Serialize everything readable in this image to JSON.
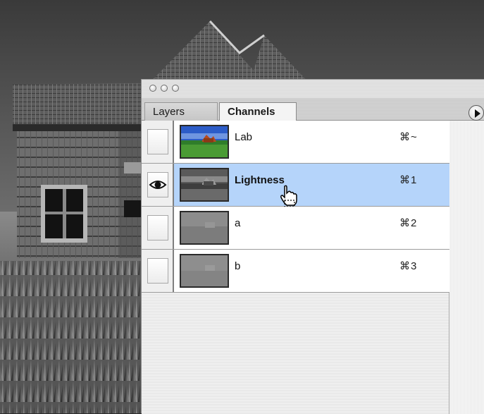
{
  "palette": {
    "tabs": [
      {
        "label": "Layers",
        "active": false
      },
      {
        "label": "Channels",
        "active": true
      }
    ],
    "menu_icon": "triangle-right-icon",
    "channels": [
      {
        "name": "Lab",
        "shortcut": "⌘~",
        "visible": false,
        "selected": false,
        "thumbnail": "color"
      },
      {
        "name": "Lightness",
        "shortcut": "⌘1",
        "visible": true,
        "selected": true,
        "thumbnail": "grayscale"
      },
      {
        "name": "a",
        "shortcut": "⌘2",
        "visible": false,
        "selected": false,
        "thumbnail": "flat-gray"
      },
      {
        "name": "b",
        "shortcut": "⌘3",
        "visible": false,
        "selected": false,
        "thumbnail": "flat-gray"
      }
    ]
  },
  "colors": {
    "selection": "#b5d4fa",
    "row_background": "#ffffff",
    "panel_background": "#efefef"
  }
}
